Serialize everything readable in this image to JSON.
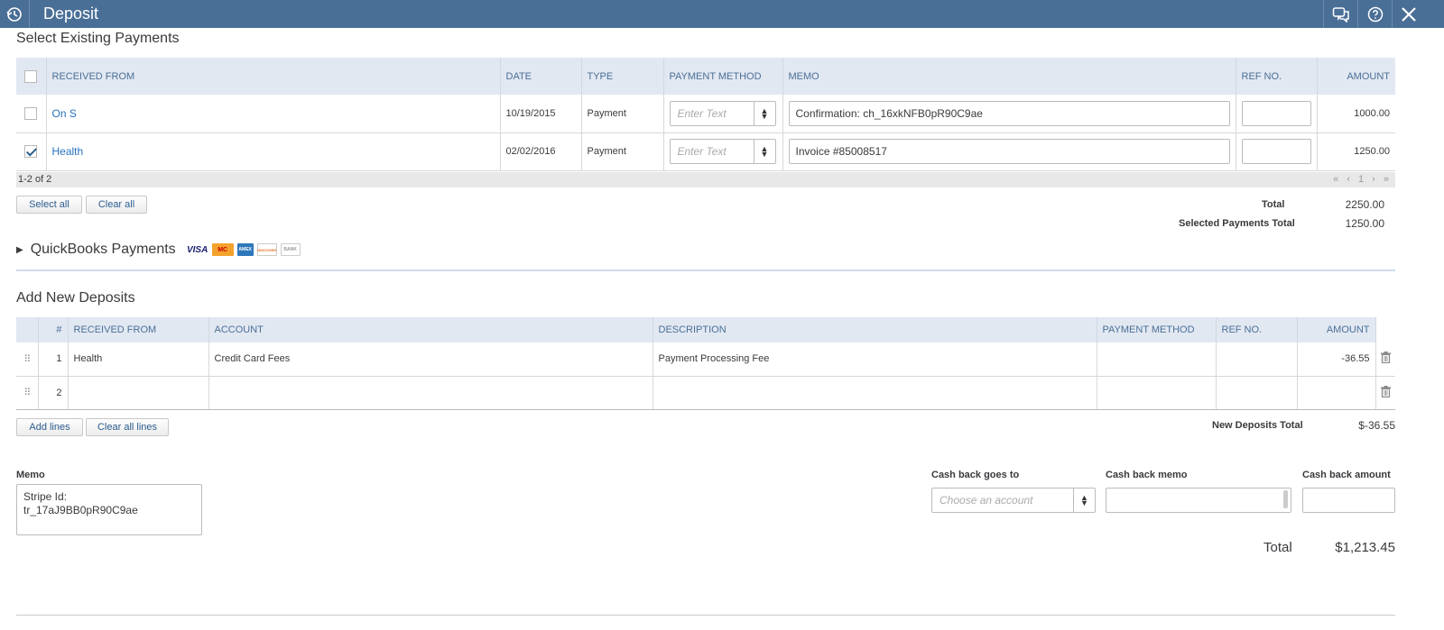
{
  "window": {
    "title": "Deposit"
  },
  "existing": {
    "section_title": "Select Existing Payments",
    "headers": {
      "received_from": "RECEIVED FROM",
      "date": "DATE",
      "type": "TYPE",
      "payment_method": "PAYMENT METHOD",
      "memo": "MEMO",
      "ref_no": "REF NO.",
      "amount": "AMOUNT"
    },
    "rows": [
      {
        "checked": false,
        "received_from": "On S",
        "date": "10/19/2015",
        "type": "Payment",
        "payment_method_placeholder": "Enter Text",
        "memo": "Confirmation: ch_16xkNFB0pR90C9ae",
        "ref_no": "",
        "amount": "1000.00"
      },
      {
        "checked": true,
        "received_from": "Health",
        "date": "02/02/2016",
        "type": "Payment",
        "payment_method_placeholder": "Enter Text",
        "memo": "Invoice #85008517",
        "ref_no": "",
        "amount": "1250.00"
      }
    ],
    "pagination": {
      "range": "1-2 of 2",
      "nav": "« ‹ 1 › »"
    },
    "select_all_label": "Select all",
    "clear_all_label": "Clear all",
    "total_label": "Total",
    "total_value": "2250.00",
    "selected_total_label": "Selected Payments Total",
    "selected_total_value": "1250.00"
  },
  "qb_payments": {
    "label": "QuickBooks Payments",
    "cards": [
      {
        "name": "visa-icon",
        "text": "VISA"
      },
      {
        "name": "mastercard-icon",
        "text": "MC"
      },
      {
        "name": "amex-icon",
        "text": "AMEX"
      },
      {
        "name": "discover-icon",
        "text": "DISCOVER"
      },
      {
        "name": "bank-icon",
        "text": "BANK"
      }
    ]
  },
  "new_deposits": {
    "section_title": "Add New Deposits",
    "headers": {
      "num": "#",
      "received_from": "RECEIVED FROM",
      "account": "ACCOUNT",
      "description": "DESCRIPTION",
      "payment_method": "PAYMENT METHOD",
      "ref_no": "REF NO.",
      "amount": "AMOUNT"
    },
    "rows": [
      {
        "num": "1",
        "received_from": "Health",
        "account": "Credit Card Fees",
        "description": "Payment Processing Fee",
        "payment_method": "",
        "ref_no": "",
        "amount": "-36.55"
      },
      {
        "num": "2",
        "received_from": "",
        "account": "",
        "description": "",
        "payment_method": "",
        "ref_no": "",
        "amount": ""
      }
    ],
    "add_lines_label": "Add lines",
    "clear_all_lines_label": "Clear all lines",
    "total_label": "New Deposits Total",
    "total_value": "$-36.55"
  },
  "footer": {
    "memo_label": "Memo",
    "memo_value": "Stripe Id:\ntr_17aJ9BB0pR90C9ae",
    "cash_back_to_label": "Cash back goes to",
    "cash_back_to_placeholder": "Choose an account",
    "cash_back_memo_label": "Cash back memo",
    "cash_back_amount_label": "Cash back amount",
    "total_label": "Total",
    "total_value": "$1,213.45"
  }
}
